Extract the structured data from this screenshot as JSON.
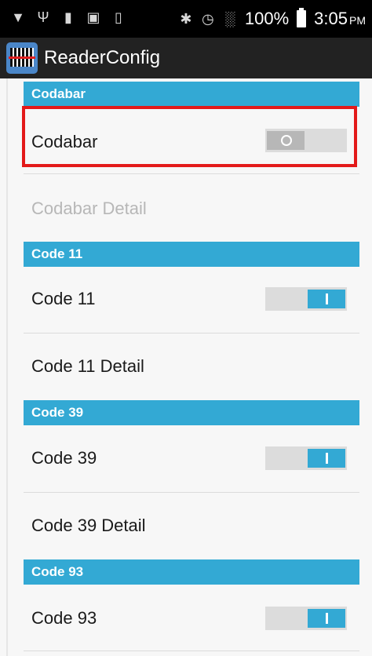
{
  "status_bar": {
    "battery_percent": "100%",
    "time": "3:05",
    "time_suffix": "PM",
    "icons": [
      "wifi-question-icon",
      "usb-icon",
      "sd-card-icon",
      "image-icon",
      "barcode-icon",
      "bluetooth-icon",
      "alarm-icon",
      "signal-icon",
      "battery-icon"
    ]
  },
  "action_bar": {
    "title": "ReaderConfig",
    "logo_icon": "barcode-scanner-icon"
  },
  "colors": {
    "accent": "#33a9d4",
    "highlight": "#e31a1a",
    "action_bar_bg": "#222222"
  },
  "sections": [
    {
      "header": "Codabar",
      "toggle_label": "Codabar",
      "toggle_on": false,
      "detail_label": "Codabar Detail",
      "detail_enabled": false
    },
    {
      "header": "Code 11",
      "toggle_label": "Code 11",
      "toggle_on": true,
      "detail_label": "Code 11 Detail",
      "detail_enabled": true
    },
    {
      "header": "Code 39",
      "toggle_label": "Code 39",
      "toggle_on": true,
      "detail_label": "Code 39 Detail",
      "detail_enabled": true
    },
    {
      "header": "Code 93",
      "toggle_label": "Code 93",
      "toggle_on": true
    }
  ]
}
